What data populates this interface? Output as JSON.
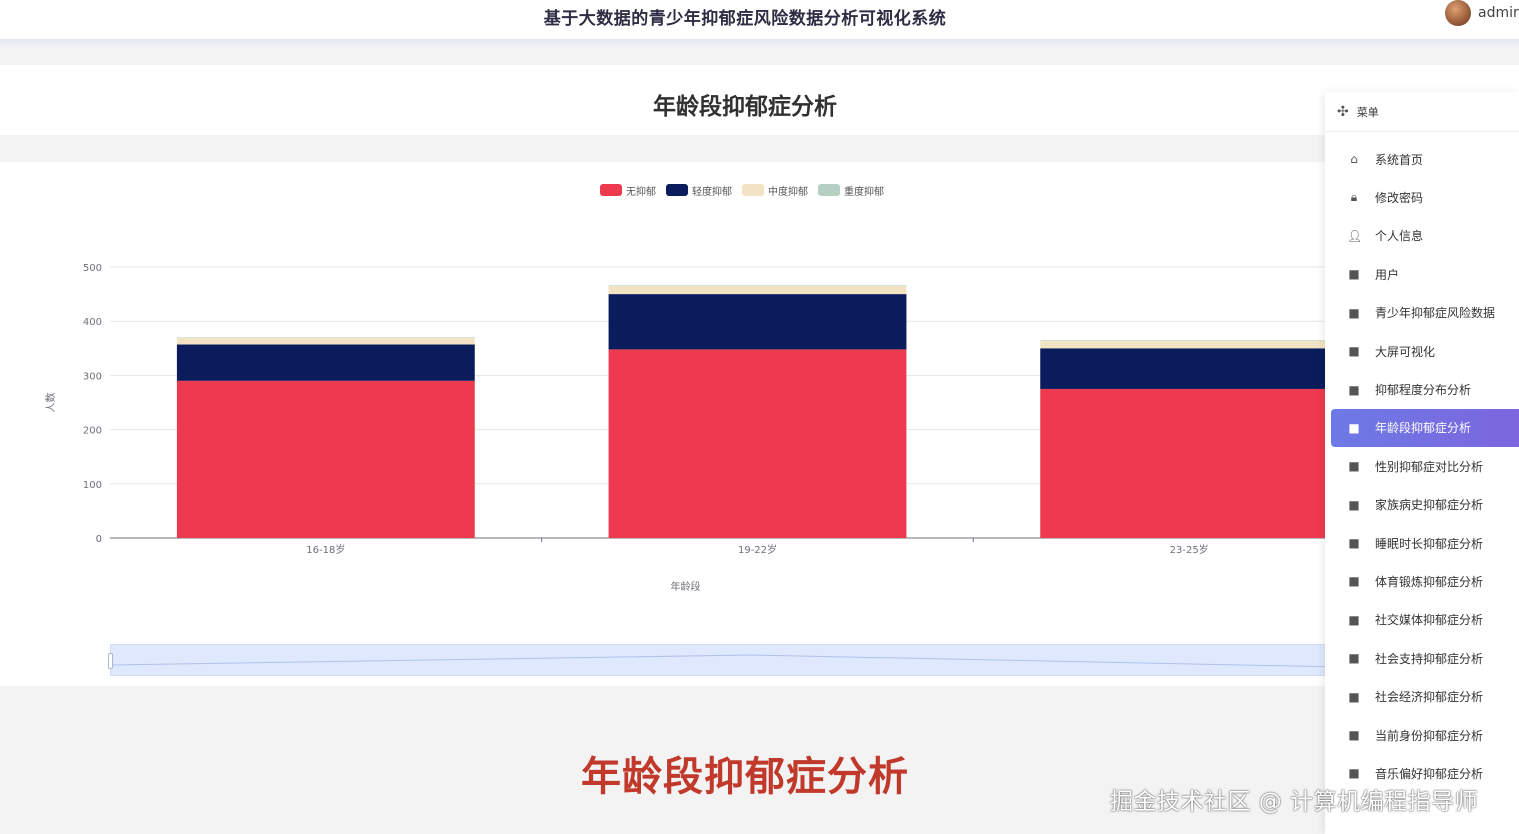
{
  "app": {
    "title": "基于大数据的青少年抑郁症风险数据分析可视化系统",
    "user": "admin"
  },
  "page": {
    "title": "年龄段抑郁症分析",
    "banner": "年龄段抑郁症分析",
    "watermark": "掘金技术社区 @ 计算机编程指导师"
  },
  "menu": {
    "header": "菜单",
    "items": [
      {
        "label": "系统首页",
        "icon": "home-icon",
        "glyph": "⌂"
      },
      {
        "label": "修改密码",
        "icon": "lock-icon",
        "glyph": "🔒︎"
      },
      {
        "label": "个人信息",
        "icon": "user-icon",
        "glyph": "👤︎"
      },
      {
        "label": "用户",
        "icon": "grid-icon",
        "glyph": "■"
      },
      {
        "label": "青少年抑郁症风险数据",
        "icon": "grid-icon",
        "glyph": "■"
      },
      {
        "label": "大屏可视化",
        "icon": "grid-icon",
        "glyph": "■"
      },
      {
        "label": "抑郁程度分布分析",
        "icon": "grid-icon",
        "glyph": "■"
      },
      {
        "label": "年龄段抑郁症分析",
        "icon": "grid-icon",
        "glyph": "■",
        "active": true
      },
      {
        "label": "性别抑郁症对比分析",
        "icon": "grid-icon",
        "glyph": "■"
      },
      {
        "label": "家族病史抑郁症分析",
        "icon": "grid-icon",
        "glyph": "■"
      },
      {
        "label": "睡眠时长抑郁症分析",
        "icon": "grid-icon",
        "glyph": "■"
      },
      {
        "label": "体育锻炼抑郁症分析",
        "icon": "grid-icon",
        "glyph": "■"
      },
      {
        "label": "社交媒体抑郁症分析",
        "icon": "grid-icon",
        "glyph": "■"
      },
      {
        "label": "社会支持抑郁症分析",
        "icon": "grid-icon",
        "glyph": "■"
      },
      {
        "label": "社会经济抑郁症分析",
        "icon": "grid-icon",
        "glyph": "■"
      },
      {
        "label": "当前身份抑郁症分析",
        "icon": "grid-icon",
        "glyph": "■"
      },
      {
        "label": "音乐偏好抑郁症分析",
        "icon": "grid-icon",
        "glyph": "■"
      }
    ]
  },
  "chart_data": {
    "type": "bar",
    "stacked": true,
    "categories": [
      "16-18岁",
      "19-22岁",
      "23-25岁"
    ],
    "series": [
      {
        "name": "无抑郁",
        "values": [
          290,
          348,
          275
        ],
        "color": "#ee3a4f"
      },
      {
        "name": "轻度抑郁",
        "values": [
          67,
          102,
          75
        ],
        "color": "#0b1c5c"
      },
      {
        "name": "中度抑郁",
        "values": [
          12,
          15,
          14
        ],
        "color": "#f2e3c4"
      },
      {
        "name": "重度抑郁",
        "values": [
          1,
          1,
          1
        ],
        "color": "#b5cfc3"
      }
    ],
    "xlabel": "年龄段",
    "ylabel": "人数",
    "ylim": [
      0,
      500
    ],
    "yticks": [
      0,
      100,
      200,
      300,
      400,
      500
    ],
    "grid": true,
    "legend": "top-center",
    "datazoom": true
  }
}
